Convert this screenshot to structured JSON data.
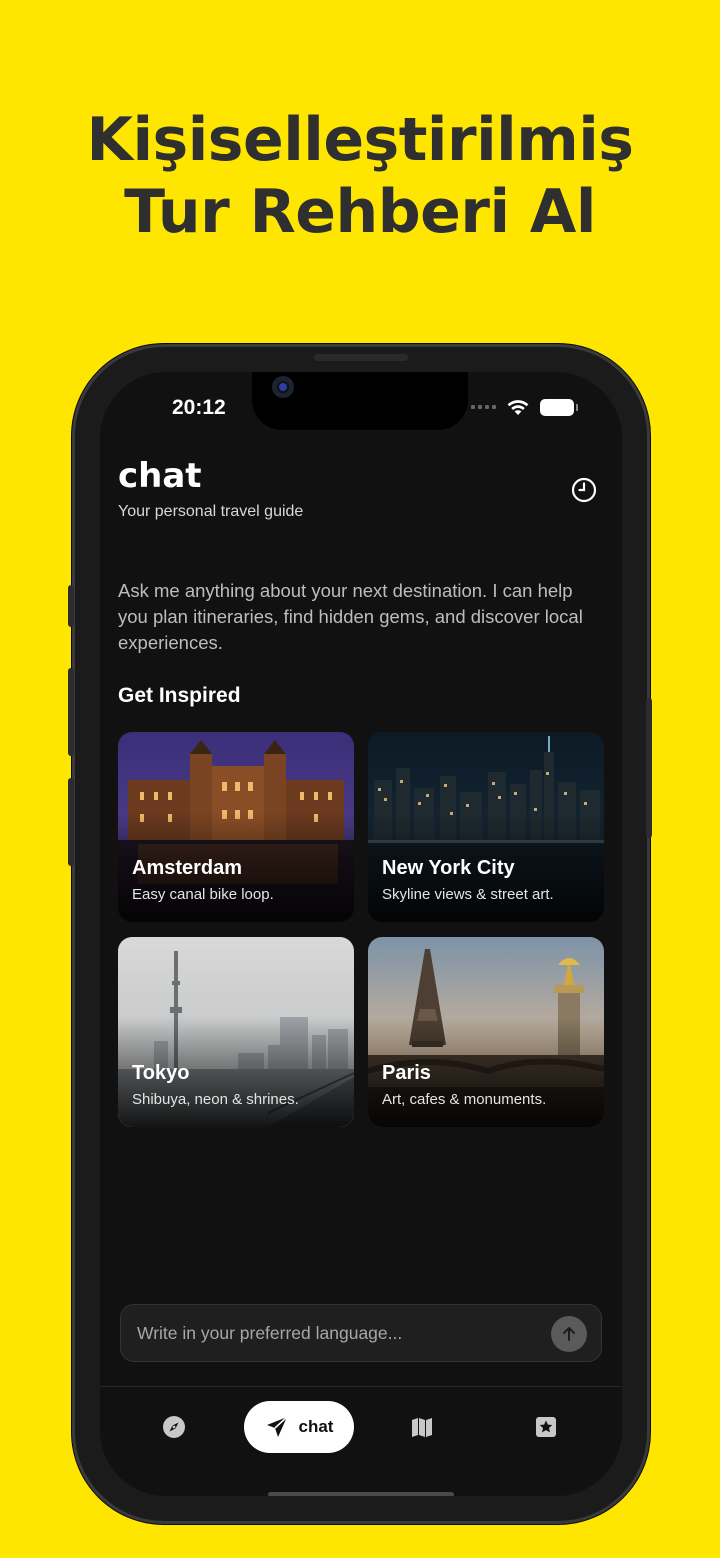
{
  "banner": {
    "line1": "Kişiselleştirilmiş",
    "line2": "Tur Rehberi Al"
  },
  "status_bar": {
    "time": "20:12"
  },
  "header": {
    "title": "chat",
    "subtitle": "Your personal travel guide",
    "history_icon": "clock-icon"
  },
  "intro_text": "Ask me anything about your next destination. I can help you plan itineraries, find hidden gems, and discover local experiences.",
  "inspiration": {
    "title": "Get Inspired",
    "cards": [
      {
        "name": "Amsterdam",
        "desc": "Easy canal bike loop."
      },
      {
        "name": "New York City",
        "desc": "Skyline views & street art."
      },
      {
        "name": "Tokyo",
        "desc": "Shibuya, neon & shrines."
      },
      {
        "name": "Paris",
        "desc": "Art, cafes & monuments."
      }
    ]
  },
  "composer": {
    "placeholder": "Write in your preferred language...",
    "send_icon": "arrow-up-icon"
  },
  "tabbar": {
    "items": [
      {
        "icon": "compass-icon"
      },
      {
        "icon": "paper-plane-icon",
        "label": "chat",
        "active": true
      },
      {
        "icon": "map-icon"
      },
      {
        "icon": "star-badge-icon"
      }
    ]
  },
  "colors": {
    "background": "#FFE600",
    "screen": "#111111",
    "headline": "#2f2f2f"
  }
}
